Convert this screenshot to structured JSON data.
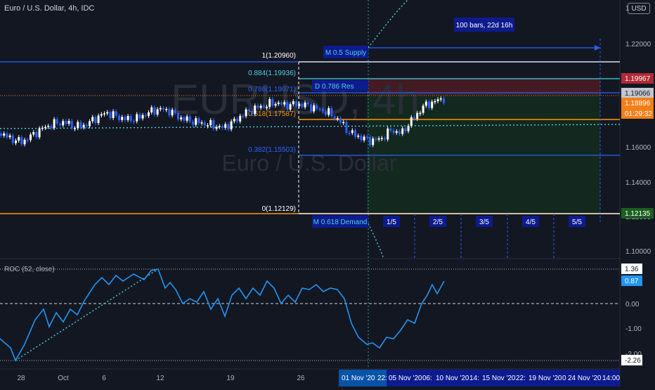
{
  "header": {
    "title": "Euro / U.S. Dollar, 4h, IDC",
    "currency_button": "USD"
  },
  "watermark": {
    "symbol": "EURUSD, 4h",
    "name": "Euro / U.S. Dollar"
  },
  "price_axis": {
    "ticks": [
      "1.22000",
      "1.20000",
      "1.18000",
      "1.16000",
      "1.14000",
      "1.12000",
      "1.10000"
    ],
    "top_tick": "1"
  },
  "price_badges": [
    {
      "label": "1.19967",
      "color": "#b22833"
    },
    {
      "label": "1.19066",
      "color": "#c3c6ce"
    },
    {
      "label": "1.18896",
      "color": "#f57f17"
    },
    {
      "label": "01:29:32",
      "color": "#f57f17"
    },
    {
      "label": "1.12135",
      "color": "#1b5e20"
    }
  ],
  "fib_levels": [
    {
      "label": "1(1.20960)",
      "color": "#ffffff"
    },
    {
      "label": "0.884(1.19936)",
      "color": "#4dd0e1"
    },
    {
      "label": "0.786(1.19071)",
      "color": "#2962ff"
    },
    {
      "label": "0.618(1.17587)",
      "color": "#ff9800"
    },
    {
      "label": "0.382(1.15503)",
      "color": "#2962ff"
    },
    {
      "label": "0(1.12129)",
      "color": "#ffffff"
    }
  ],
  "annotations": {
    "range_box": "100 bars, 22d 16h",
    "supply": "M 0.5 Supply",
    "resistance": "D 0.786 Res",
    "demand": "M 0.618 Demand",
    "fractions": [
      "1/5",
      "2/5",
      "3/5",
      "4/5",
      "5/5"
    ]
  },
  "roc": {
    "label": "ROC (52, close)",
    "axis_ticks": [
      "0.00",
      "-1.00",
      "-2.00"
    ],
    "badges": [
      {
        "label": "1.36",
        "color": "#ffffff"
      },
      {
        "label": "0.87",
        "color": "#2196f3"
      },
      {
        "label": "-2.26",
        "color": "#ffffff"
      }
    ]
  },
  "time_axis": {
    "ticks": [
      "28",
      "Oct",
      "6",
      "12",
      "19",
      "26"
    ],
    "range_labels": [
      "01 Nov '20",
      "22:",
      "05 Nov '20",
      "06:",
      "10 Nov '20",
      "14:",
      "15 Nov '20",
      "22:",
      "19 Nov '20",
      "0",
      "24 Nov '20",
      "14:00"
    ]
  },
  "colors": {
    "background": "#131722",
    "bull": "#ffffff",
    "bear": "#2962ff",
    "roc_line": "#2196f3",
    "accent_blue": "#0d1b8f"
  }
}
